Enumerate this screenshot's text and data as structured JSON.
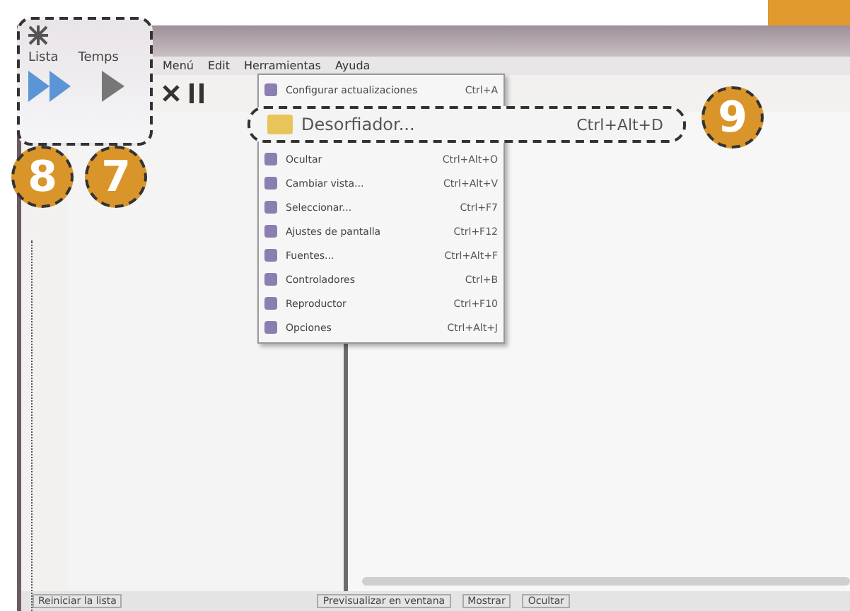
{
  "zoom_callout": {
    "menu": [
      "Lista",
      "Temps"
    ],
    "badges": [
      "8",
      "7"
    ]
  },
  "window": {
    "menu_bar": [
      "Menú",
      "Edit",
      "Herramientas",
      "Ayuda"
    ]
  },
  "dropdown": {
    "items": [
      {
        "label": "Configurar actualizaciones",
        "shortcut": "Ctrl+A",
        "selected": false
      },
      {
        "label": "Desorfiador...",
        "shortcut": "Ctrl+Alt+D",
        "selected": true,
        "badge": "9"
      },
      {
        "label": "Ocultar",
        "shortcut": "Ctrl+Alt+O",
        "selected": false
      },
      {
        "label": "Cambiar vista...",
        "shortcut": "Ctrl+Alt+V",
        "selected": false
      },
      {
        "label": "Seleccionar...",
        "shortcut": "Ctrl+F7",
        "selected": false
      },
      {
        "label": "Ajustes de pantalla",
        "shortcut": "Ctrl+F12",
        "selected": false
      },
      {
        "label": "Fuentes...",
        "shortcut": "Ctrl+Alt+F",
        "selected": false
      },
      {
        "label": "Controladores",
        "shortcut": "Ctrl+B",
        "selected": false
      },
      {
        "label": "Reproductor",
        "shortcut": "Ctrl+F10",
        "selected": false
      },
      {
        "label": "Opciones",
        "shortcut": "Ctrl+Alt+J",
        "selected": false
      }
    ]
  },
  "status_bar": [
    "Reiniciar la lista",
    "Previsualizar en ventana",
    "Mostrar",
    "Ocultar"
  ]
}
